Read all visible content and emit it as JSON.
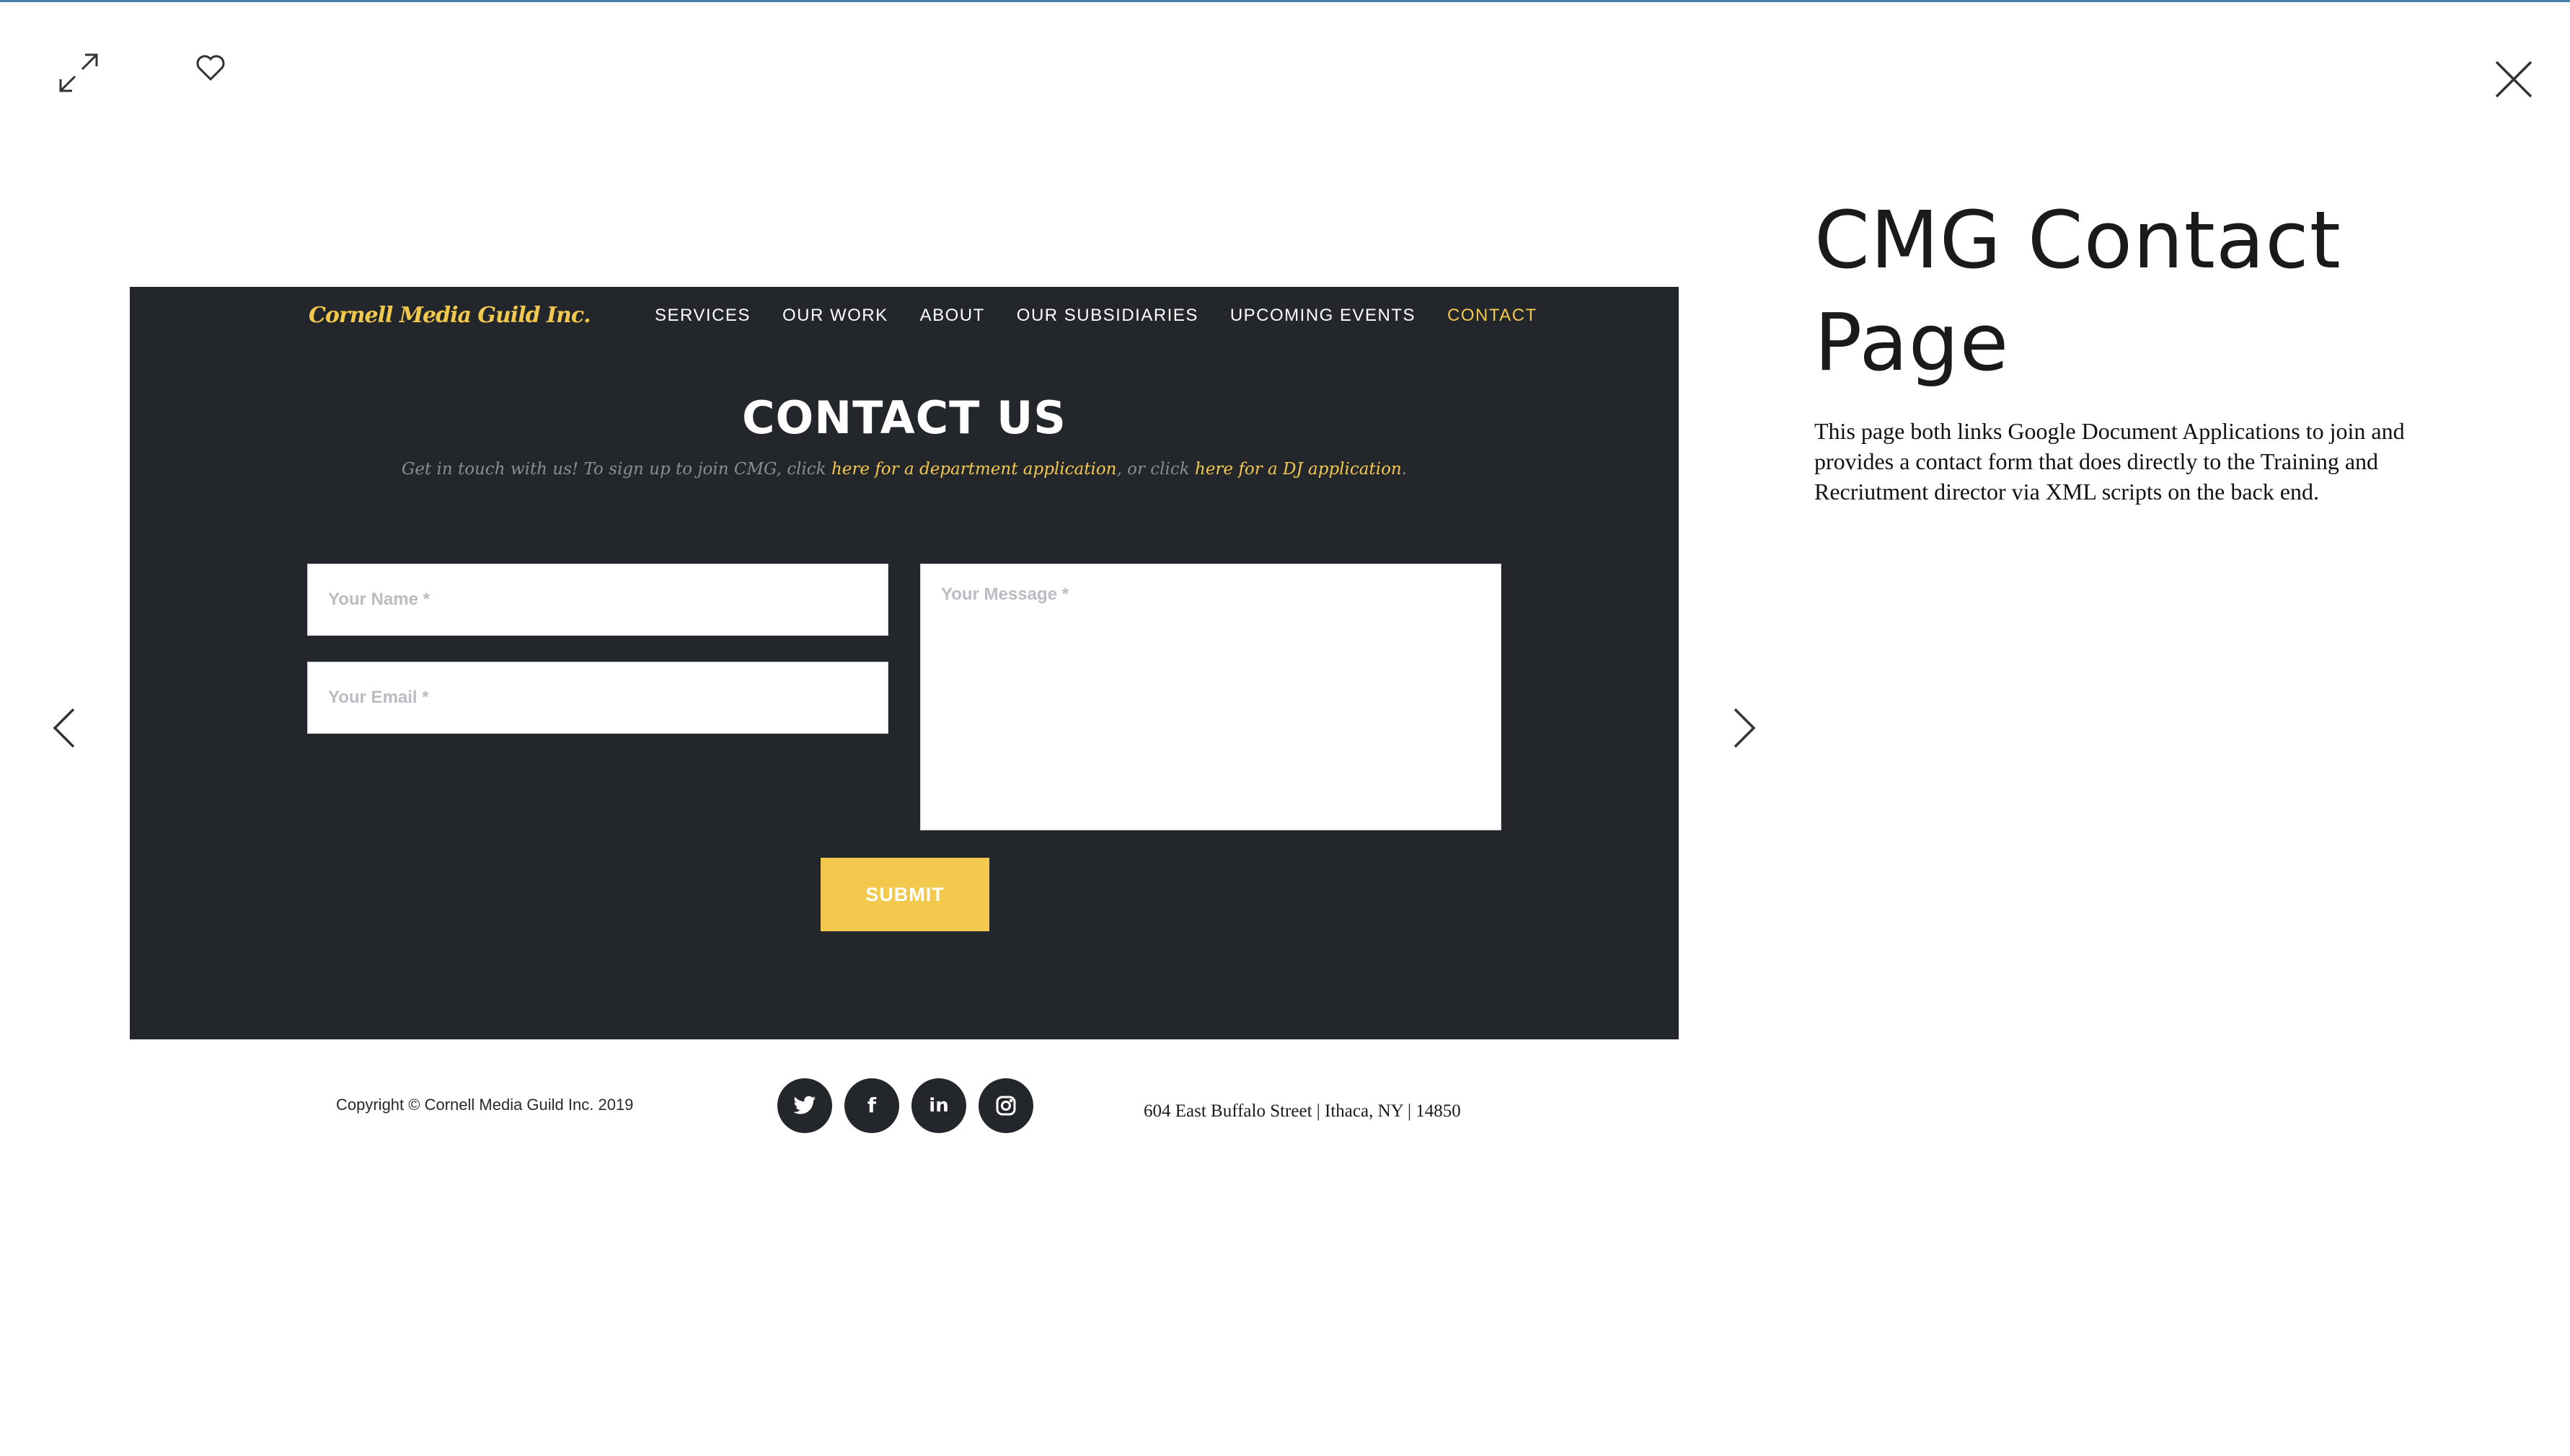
{
  "viewer": {
    "expand_icon": "expand-arrows-icon",
    "favorite_icon": "heart-icon",
    "close_icon": "close-x-icon",
    "prev_icon": "chevron-left-icon",
    "next_icon": "chevron-right-icon"
  },
  "site": {
    "logo": "Cornell Media Guild Inc.",
    "nav": [
      "SERVICES",
      "OUR WORK",
      "ABOUT",
      "OUR SUBSIDIARIES",
      "UPCOMING EVENTS",
      "CONTACT"
    ],
    "active_nav": "CONTACT",
    "heading": "CONTACT US",
    "intro_text_1": "Get in touch with us! To sign up to join CMG, click ",
    "intro_link_1": "here for a department application",
    "intro_text_2": ", or click ",
    "intro_link_2": "here for a DJ application",
    "intro_text_3": ".",
    "form": {
      "name_placeholder": "Your Name *",
      "email_placeholder": "Your Email *",
      "message_placeholder": "Your Message *",
      "submit_label": "SUBMIT"
    },
    "colors": {
      "dark_bg": "#23262b",
      "accent": "#f2c94c"
    }
  },
  "footer": {
    "copyright": "Copyright © Cornell Media Guild Inc. 2019",
    "social": [
      {
        "name": "twitter-icon",
        "glyph": "🐦"
      },
      {
        "name": "facebook-icon",
        "glyph": "f"
      },
      {
        "name": "linkedin-icon",
        "glyph": "in"
      },
      {
        "name": "instagram-icon",
        "glyph": "◎"
      }
    ],
    "address": "604 East Buffalo Street | Ithaca, NY | 14850"
  },
  "project": {
    "title": "CMG Contact Page",
    "description": "This page both links Google Document Applications to join and provides a contact form that does directly to the Training and Recriutment director via XML scripts on the back end."
  }
}
